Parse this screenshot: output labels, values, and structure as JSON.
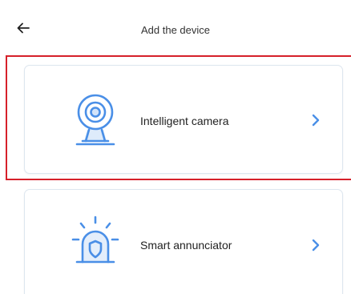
{
  "header": {
    "title": "Add the device",
    "back_icon": "arrow-left-icon"
  },
  "devices": [
    {
      "label": "Intelligent camera",
      "icon": "camera-icon",
      "selected": true
    },
    {
      "label": "Smart annunciator",
      "icon": "alarm-siren-icon",
      "selected": false
    }
  ],
  "colors": {
    "icon_blue": "#4a8fe7",
    "highlight_red": "#d6202a",
    "card_border": "#dde6ef"
  }
}
